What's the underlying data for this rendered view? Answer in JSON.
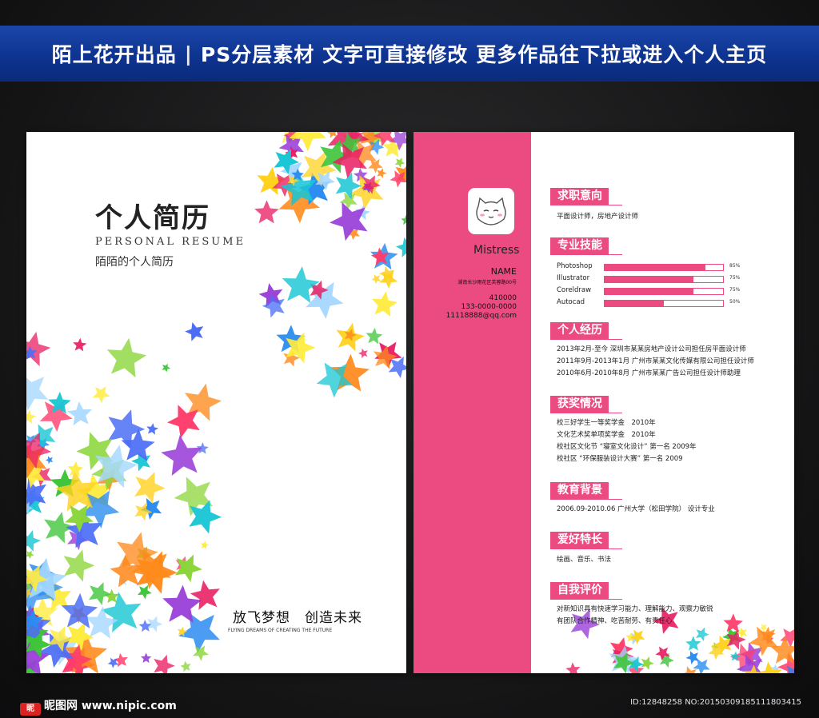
{
  "banner": {
    "brand": "陌上花开出品",
    "separator": "|",
    "text1": "PS分层素材",
    "text2": "文字可直接修改",
    "text3": "更多作品往下拉或进入个人主页"
  },
  "cover": {
    "title": "个人简历",
    "subtitle_en": "PERSONAL RESUME",
    "subtitle_cn": "陌陌的个人简历",
    "slogan": "放飞梦想　创造未来",
    "slogan_en": "FLYING DREAMS OF CREATING THE FUTURE"
  },
  "profile": {
    "nickname": "Mistress",
    "name": "NAME",
    "address": "湖南长沙雨花区芙蓉路00号",
    "zip": "410000",
    "phone": "133-0000-0000",
    "email": "11118888@qq.com"
  },
  "sections": {
    "intent": {
      "title": "求职意向",
      "content": "平面设计师，房地产设计师"
    },
    "skills": {
      "title": "专业技能",
      "items": [
        {
          "name": "Photoshop",
          "level": 0.85,
          "label": "85%"
        },
        {
          "name": "Illustrator",
          "level": 0.75,
          "label": "75%"
        },
        {
          "name": "Coreldraw",
          "level": 0.75,
          "label": "75%"
        },
        {
          "name": "Autocad",
          "level": 0.5,
          "label": "50%"
        }
      ]
    },
    "experience": {
      "title": "个人经历",
      "items": [
        "2013年2月-至今 深圳市某某房地产设计公司担任房平面设计师",
        "2011年9月-2013年1月 广州市某某文化传媒有限公司担任设计师",
        "2010年6月-2010年8月 广州市某某广告公司担任设计师助理"
      ]
    },
    "awards": {
      "title": "获奖情况",
      "items": [
        "校三好学生一等奖学金　2010年",
        "文化艺术奖单项奖学金　2010年",
        "校社区文化节 “寝室文化设计” 第一名 2009年",
        "校社区 “环保服装设计大赛” 第一名 2009"
      ]
    },
    "education": {
      "title": "教育背景",
      "content": "2006.09-2010.06 广州大学（松田学院） 设计专业"
    },
    "hobbies": {
      "title": "爱好特长",
      "content": "绘画、音乐、书法"
    },
    "self": {
      "title": "自我评价",
      "items": [
        "对新知识具有快速学习能力、理解能力、观察力敏锐",
        "有团队合作精神、吃苦耐劳、有责任心"
      ]
    }
  },
  "footer": {
    "logo_text": "昵图网 www.nipic.com",
    "id_text": "ID:12848258 NO:20150309185111803415"
  },
  "colors": {
    "accent": "#ec4b82",
    "banner": "#0e3491",
    "background": "#1a1a1b"
  }
}
